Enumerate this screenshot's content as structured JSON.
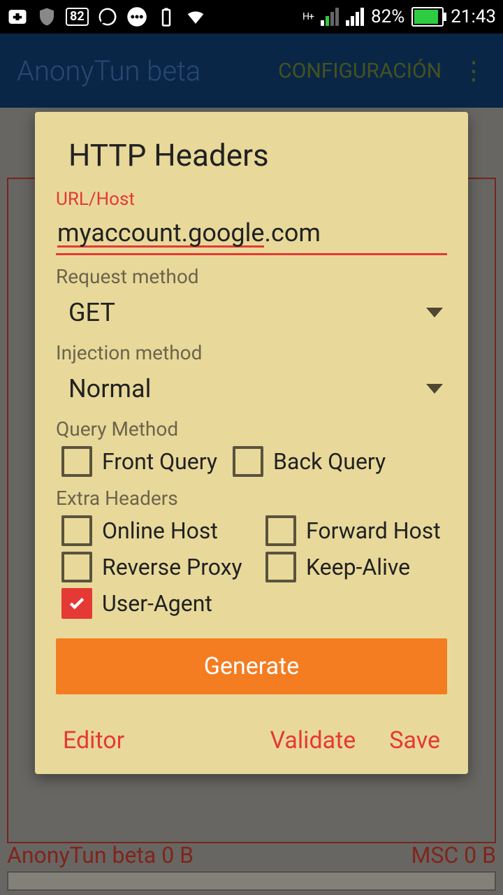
{
  "status": {
    "battery_badge": "82",
    "battery_percent": "82%",
    "time": "21:43",
    "hplus": "H+"
  },
  "appbar": {
    "title": "AnonyTun beta",
    "config": "CONFIGURACIÓN",
    "menu_glyph": "⋮"
  },
  "background": {
    "left_status": "AnonyTun beta 0 B",
    "right_status": "MSC 0 B"
  },
  "dialog": {
    "title": "HTTP Headers",
    "url_label": "URL/Host",
    "url_spell_part": "myaccount.google",
    "url_rest": ".com",
    "req_method_label": "Request method",
    "req_method_value": "GET",
    "inj_method_label": "Injection method",
    "inj_method_value": "Normal",
    "query_label": "Query Method",
    "front_query": "Front Query",
    "back_query": "Back Query",
    "extra_label": "Extra Headers",
    "online_host": "Online Host",
    "forward_host": "Forward Host",
    "reverse_proxy": "Reverse Proxy",
    "keep_alive": "Keep-Alive",
    "user_agent": "User-Agent",
    "generate": "Generate",
    "editor": "Editor",
    "validate": "Validate",
    "save": "Save"
  }
}
